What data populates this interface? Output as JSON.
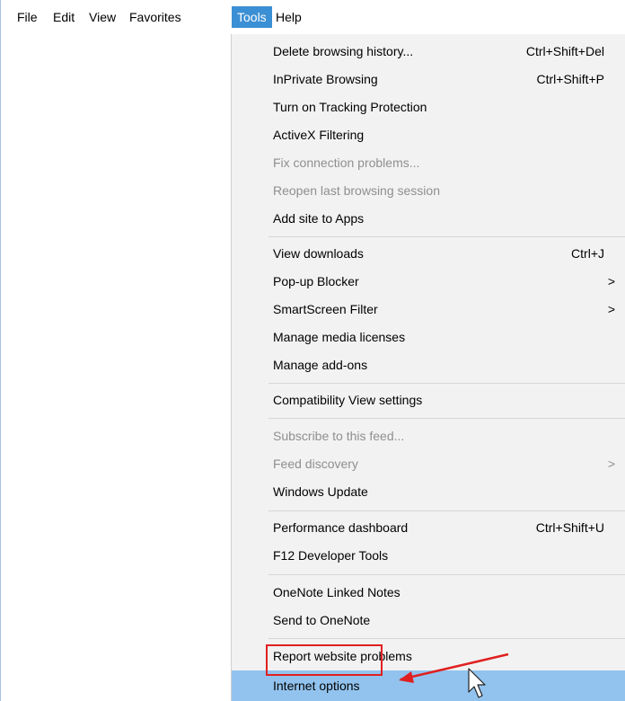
{
  "menubar": {
    "items": [
      {
        "label": "File",
        "active": false
      },
      {
        "label": "Edit",
        "active": false
      },
      {
        "label": "View",
        "active": false
      },
      {
        "label": "Favorites",
        "active": false
      },
      {
        "label": "Tools",
        "active": true
      },
      {
        "label": "Help",
        "active": false
      }
    ]
  },
  "tools_menu": {
    "items": [
      {
        "label": "Delete browsing history...",
        "shortcut": "Ctrl+Shift+Del",
        "enabled": true
      },
      {
        "label": "InPrivate Browsing",
        "shortcut": "Ctrl+Shift+P",
        "enabled": true
      },
      {
        "label": "Turn on Tracking Protection",
        "enabled": true
      },
      {
        "label": "ActiveX Filtering",
        "enabled": true
      },
      {
        "label": "Fix connection problems...",
        "enabled": false
      },
      {
        "label": "Reopen last browsing session",
        "enabled": false
      },
      {
        "label": "Add site to Apps",
        "enabled": true
      },
      {
        "label": "View downloads",
        "shortcut": "Ctrl+J",
        "enabled": true
      },
      {
        "label": "Pop-up Blocker",
        "submenu_arrow": ">",
        "enabled": true
      },
      {
        "label": "SmartScreen Filter",
        "submenu_arrow": ">",
        "enabled": true
      },
      {
        "label": "Manage media licenses",
        "enabled": true
      },
      {
        "label": "Manage add-ons",
        "enabled": true
      },
      {
        "label": "Compatibility View settings",
        "enabled": true
      },
      {
        "label": "Subscribe to this feed...",
        "enabled": false
      },
      {
        "label": "Feed discovery",
        "submenu_arrow": ">",
        "enabled": false
      },
      {
        "label": "Windows Update",
        "enabled": true
      },
      {
        "label": "Performance dashboard",
        "shortcut": "Ctrl+Shift+U",
        "enabled": true
      },
      {
        "label": "F12 Developer Tools",
        "enabled": true
      },
      {
        "label": "OneNote Linked Notes",
        "enabled": true
      },
      {
        "label": "Send to OneNote",
        "enabled": true
      },
      {
        "label": "Report website problems",
        "enabled": true
      },
      {
        "label": "Internet options",
        "enabled": true,
        "highlighted": true
      }
    ]
  },
  "colors": {
    "menubar_active": "#3b8fd4",
    "highlight_row": "#92c3ee",
    "annotation": "#e02020",
    "disabled_text": "#8f8f8f"
  }
}
